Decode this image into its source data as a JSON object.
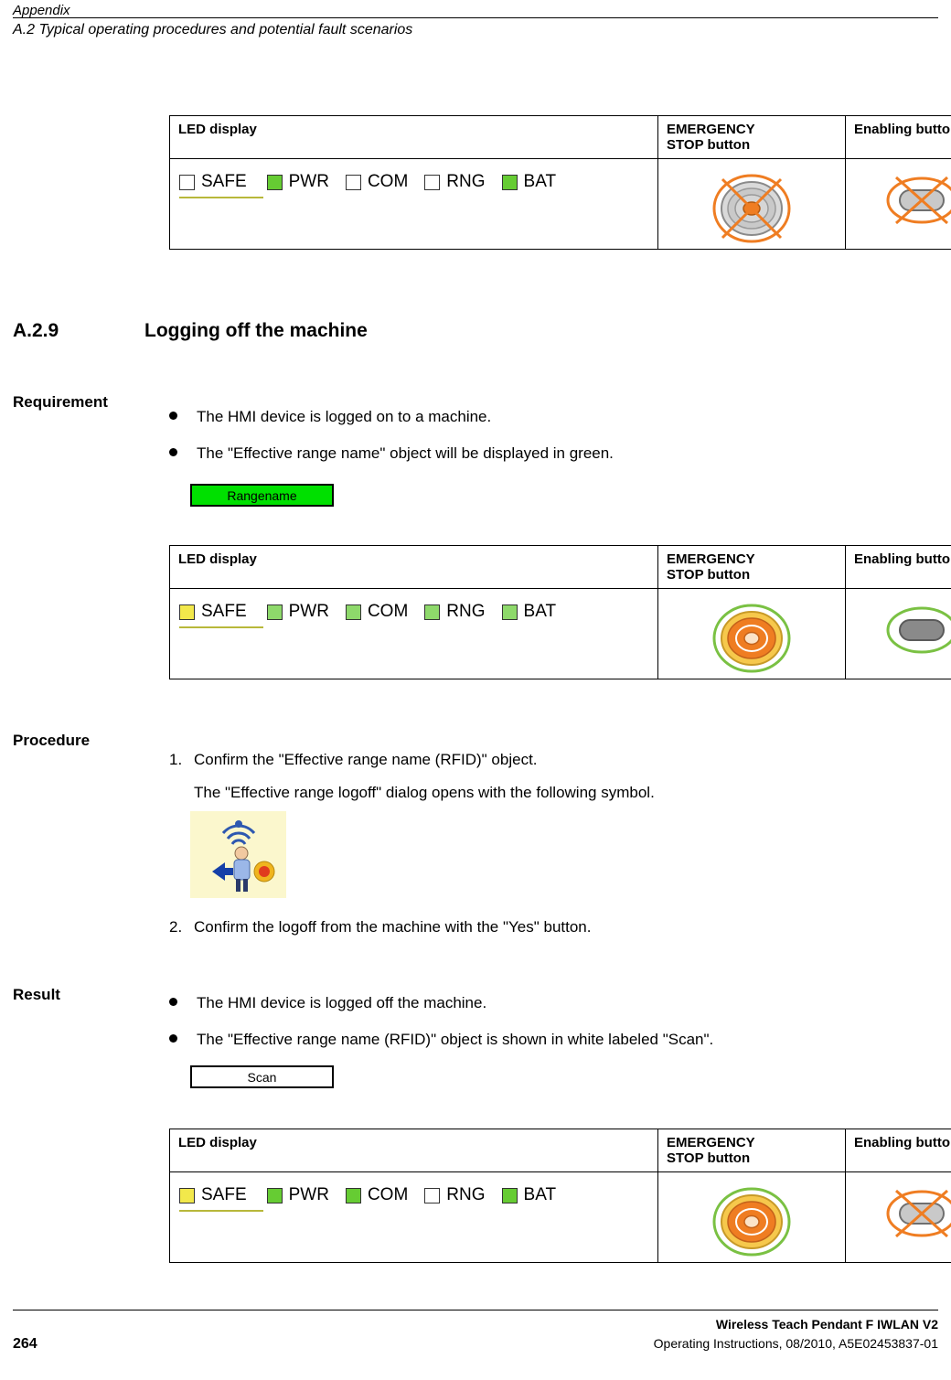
{
  "header": {
    "title": "Appendix",
    "subtitle": "A.2 Typical operating procedures and potential fault scenarios"
  },
  "section": {
    "number": "A.2.9",
    "title": "Logging off the machine"
  },
  "headings": {
    "requirement": "Requirement",
    "procedure": "Procedure",
    "result": "Result"
  },
  "requirement_bullets": [
    "The HMI device is logged on to a machine.",
    "The \"Effective range name\" object will be displayed in green."
  ],
  "procedure_steps": [
    {
      "num": "1.",
      "text": "Confirm the \"Effective range name (RFID)\" object."
    },
    {
      "num": "",
      "text": "The \"Effective range logoff\" dialog opens with the following symbol."
    },
    {
      "num": "2.",
      "text": "Confirm the logoff from the machine with the \"Yes\" button."
    }
  ],
  "result_bullets": [
    "The HMI device is logged off the machine.",
    "The \"Effective range name (RFID)\" object is shown in white labeled \"Scan\"."
  ],
  "buttons": {
    "rangename": "Rangename",
    "scan": "Scan"
  },
  "table_headers": {
    "led": "LED display",
    "estop_line1": "EMERGENCY",
    "estop_line2": "STOP button",
    "enabling": "Enabling button"
  },
  "led_labels": [
    "SAFE",
    "PWR",
    "COM",
    "RNG",
    "BAT"
  ],
  "tables": [
    {
      "id": "table-top",
      "leds": [
        {
          "label": "SAFE",
          "color": "#ffffff"
        },
        {
          "label": "PWR",
          "color": "#66cc33"
        },
        {
          "label": "COM",
          "color": "#ffffff"
        },
        {
          "label": "RNG",
          "color": "#ffffff"
        },
        {
          "label": "BAT",
          "color": "#66cc33"
        }
      ],
      "estop_state": "crossed-out-gray",
      "enabling_state": "crossed-out-gray"
    },
    {
      "id": "table-requirement",
      "leds": [
        {
          "label": "SAFE",
          "color": "#f2e84b"
        },
        {
          "label": "PWR",
          "color": "#8ed96b"
        },
        {
          "label": "COM",
          "color": "#8ed96b"
        },
        {
          "label": "RNG",
          "color": "#8ed96b"
        },
        {
          "label": "BAT",
          "color": "#8ed96b"
        }
      ],
      "estop_state": "active-orange",
      "enabling_state": "active-gray"
    },
    {
      "id": "table-result",
      "leds": [
        {
          "label": "SAFE",
          "color": "#f2e84b"
        },
        {
          "label": "PWR",
          "color": "#66cc33"
        },
        {
          "label": "COM",
          "color": "#66cc33"
        },
        {
          "label": "RNG",
          "color": "#ffffff"
        },
        {
          "label": "BAT",
          "color": "#66cc33"
        }
      ],
      "estop_state": "active-orange",
      "enabling_state": "crossed-out-gray"
    }
  ],
  "colors": {
    "led_on_green": "#66cc33",
    "led_on_yellow": "#f2e84b",
    "led_off": "#ffffff",
    "accent_orange": "#ef7d22",
    "ring_green": "#7ac143",
    "range_green": "#00e000"
  },
  "footer": {
    "line1": "Wireless Teach Pendant F IWLAN V2",
    "line2": "Operating Instructions, 08/2010, A5E02453837-01",
    "page": "264"
  }
}
